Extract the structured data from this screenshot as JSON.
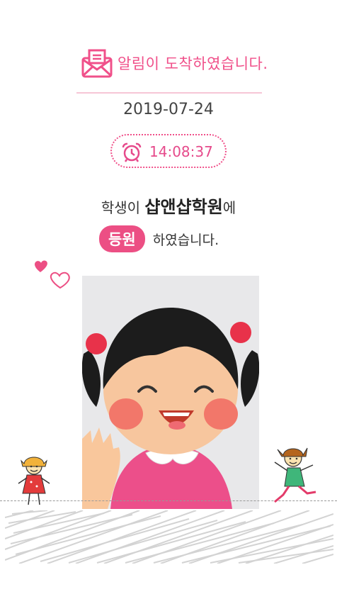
{
  "header": {
    "title": "알림이 도착하였습니다.",
    "icon": "mail-icon"
  },
  "date": "2019-07-24",
  "time": "14:08:37",
  "message": {
    "prefix": "학생이",
    "academy": "샵앤샵학원",
    "suffix": "에",
    "status": "등원",
    "status_suffix": "하였습니다."
  },
  "colors": {
    "accent": "#ec4f84",
    "divider": "#f6c6d6"
  }
}
